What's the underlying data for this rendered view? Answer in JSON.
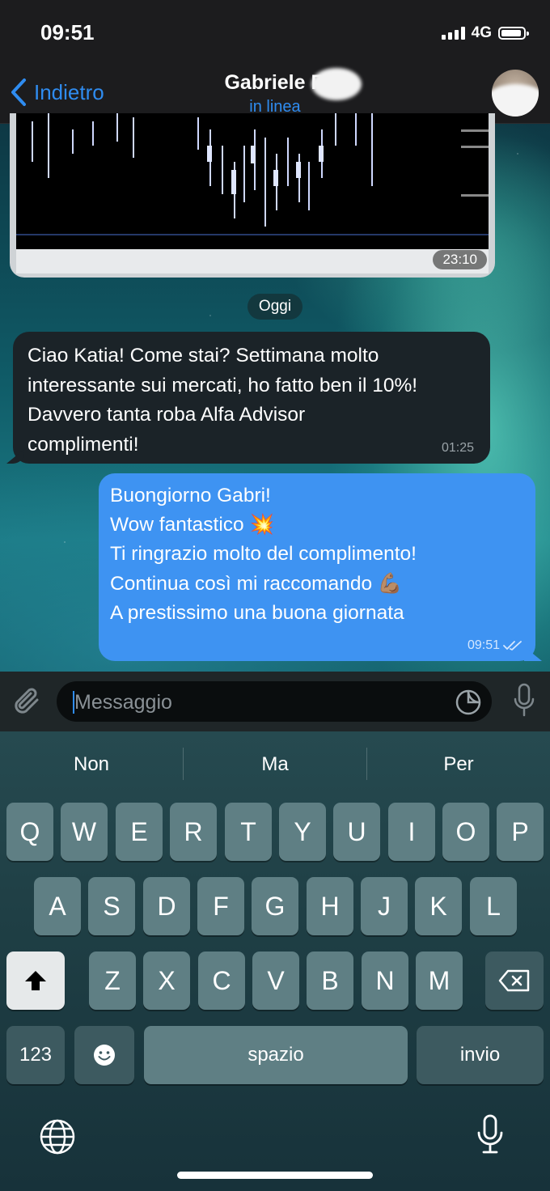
{
  "status_bar": {
    "time": "09:51",
    "network": "4G"
  },
  "nav": {
    "back_label": "Indietro",
    "contact_name": "Gabriele R",
    "contact_status": "in linea"
  },
  "messages": {
    "image_time": "23:10",
    "date_divider": "Oggi",
    "incoming": {
      "text": "Ciao Katia! Come stai? Settimana molto\ninteressante sui mercati, ho fatto ben il 10%!\nDavvero tanta roba Alfa Advisor\ncomplimenti!",
      "time": "01:25"
    },
    "outgoing": {
      "lines": [
        "Buongiorno Gabri!",
        "Wow fantastico 💥",
        "",
        "Ti ringrazio molto del complimento!",
        "Continua così mi raccomando 💪🏽",
        "A prestissimo una buona giornata"
      ],
      "time": "09:51"
    }
  },
  "composer": {
    "placeholder": "Messaggio"
  },
  "keyboard": {
    "suggestions": [
      "Non",
      "Ma",
      "Per"
    ],
    "row1": [
      "Q",
      "W",
      "E",
      "R",
      "T",
      "Y",
      "U",
      "I",
      "O",
      "P"
    ],
    "row2": [
      "A",
      "S",
      "D",
      "F",
      "G",
      "H",
      "J",
      "K",
      "L"
    ],
    "row3": [
      "Z",
      "X",
      "C",
      "V",
      "B",
      "N",
      "M"
    ],
    "numbers_label": "123",
    "space_label": "spazio",
    "return_label": "invio"
  },
  "colors": {
    "accent": "#2f8cf0",
    "outgoing_bubble": "#3e93f2",
    "incoming_bubble": "#1b2328"
  }
}
